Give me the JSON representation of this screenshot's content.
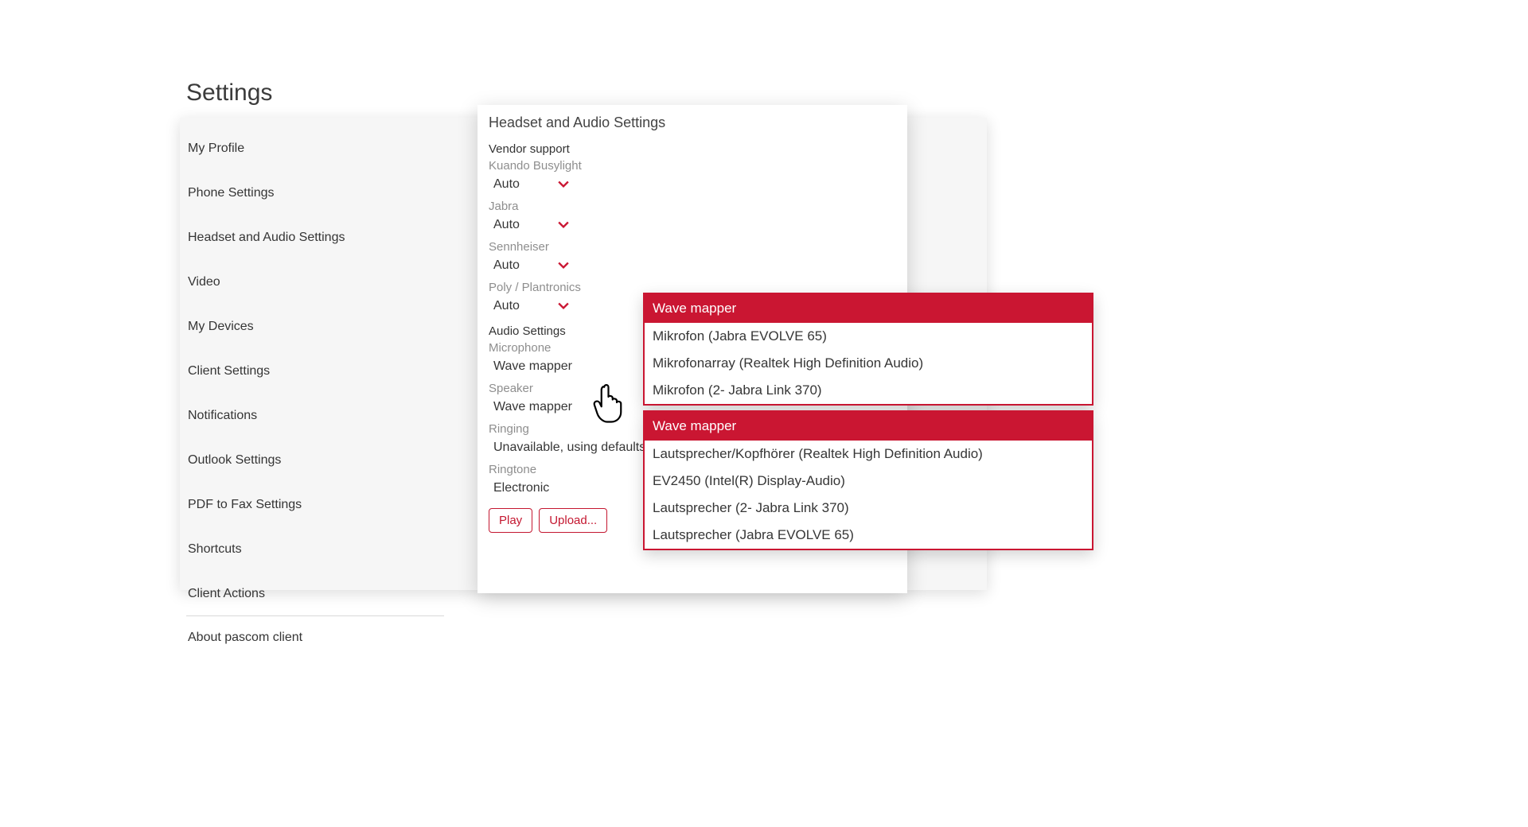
{
  "pageTitle": "Settings",
  "sidebar": {
    "items": [
      "My Profile",
      "Phone Settings",
      "Headset and Audio Settings",
      "Video",
      "My Devices",
      "Client Settings",
      "Notifications",
      "Outlook Settings",
      "PDF to Fax Settings",
      "Shortcuts",
      "Client Actions"
    ],
    "footerItem": "About pascom client"
  },
  "panel": {
    "title": "Headset and Audio Settings",
    "vendorSupport": {
      "heading": "Vendor support",
      "items": [
        {
          "label": "Kuando Busylight",
          "value": "Auto"
        },
        {
          "label": "Jabra",
          "value": "Auto"
        },
        {
          "label": "Sennheiser",
          "value": "Auto"
        },
        {
          "label": "Poly / Plantronics",
          "value": "Auto"
        }
      ]
    },
    "audioSettings": {
      "heading": "Audio Settings",
      "microphone": {
        "label": "Microphone",
        "value": "Wave mapper"
      },
      "speaker": {
        "label": "Speaker",
        "value": "Wave mapper"
      },
      "ringing": {
        "label": "Ringing",
        "value": "Unavailable, using defaults"
      },
      "ringtone": {
        "label": "Ringtone",
        "value": "Electronic"
      }
    },
    "buttons": {
      "play": "Play",
      "upload": "Upload..."
    }
  },
  "micDropdown": {
    "selected": "Wave mapper",
    "options": [
      "Mikrofon (Jabra EVOLVE 65)",
      "Mikrofonarray (Realtek High Definition Audio)",
      "Mikrofon (2- Jabra Link 370)"
    ]
  },
  "speakerDropdown": {
    "selected": "Wave mapper",
    "options": [
      "Lautsprecher/Kopfhörer (Realtek High Definition Audio)",
      "EV2450 (Intel(R) Display-Audio)",
      "Lautsprecher (2- Jabra Link 370)",
      "Lautsprecher (Jabra EVOLVE 65)"
    ]
  },
  "colors": {
    "accent": "#ca1632"
  }
}
